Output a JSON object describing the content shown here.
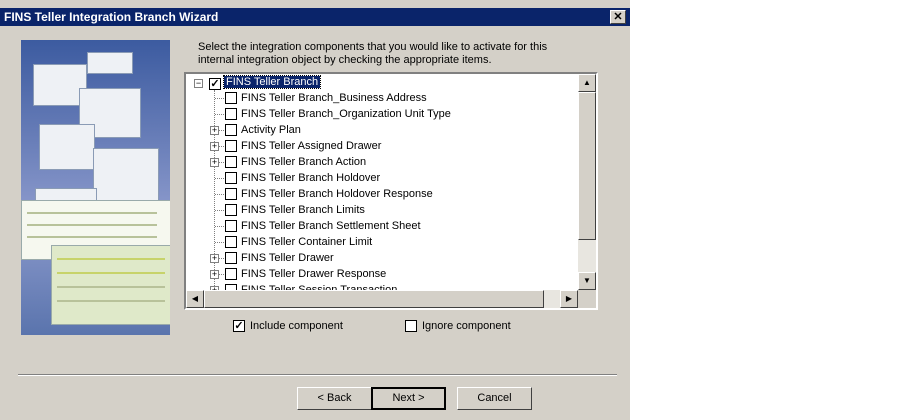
{
  "window": {
    "title": "FINS Teller Integration Branch Wizard",
    "close_glyph": "✕"
  },
  "instructions": "Select the integration components that you would like to activate for this internal integration object by checking the appropriate items.",
  "tree": {
    "root": {
      "label": "FINS Teller Branch",
      "checked": true,
      "expanded": true
    },
    "items": [
      {
        "label": "FINS Teller Branch_Business Address",
        "checked": false,
        "expandable": false
      },
      {
        "label": "FINS Teller Branch_Organization Unit Type",
        "checked": false,
        "expandable": false
      },
      {
        "label": "Activity Plan",
        "checked": false,
        "expandable": true
      },
      {
        "label": "FINS Teller Assigned Drawer",
        "checked": false,
        "expandable": true
      },
      {
        "label": "FINS Teller Branch Action",
        "checked": false,
        "expandable": true
      },
      {
        "label": "FINS Teller Branch Holdover",
        "checked": false,
        "expandable": false
      },
      {
        "label": "FINS Teller Branch Holdover Response",
        "checked": false,
        "expandable": false
      },
      {
        "label": "FINS Teller Branch Limits",
        "checked": false,
        "expandable": false
      },
      {
        "label": "FINS Teller Branch Settlement Sheet",
        "checked": false,
        "expandable": false
      },
      {
        "label": "FINS Teller Container Limit",
        "checked": false,
        "expandable": false
      },
      {
        "label": "FINS Teller Drawer",
        "checked": false,
        "expandable": true
      },
      {
        "label": "FINS Teller Drawer Response",
        "checked": false,
        "expandable": true
      },
      {
        "label": "FINS Teller Session Transaction",
        "checked": false,
        "expandable": true
      }
    ]
  },
  "legend": {
    "include_label": "Include component",
    "ignore_label": "Ignore component"
  },
  "buttons": {
    "back": "< Back",
    "next": "Next >",
    "cancel": "Cancel"
  },
  "scroll_glyphs": {
    "up": "▲",
    "down": "▼",
    "left": "◀",
    "right": "▶"
  },
  "colors": {
    "title_bar": "#0a246a",
    "dialog_bg": "#d4d0c8",
    "selection": "#0a246a"
  }
}
